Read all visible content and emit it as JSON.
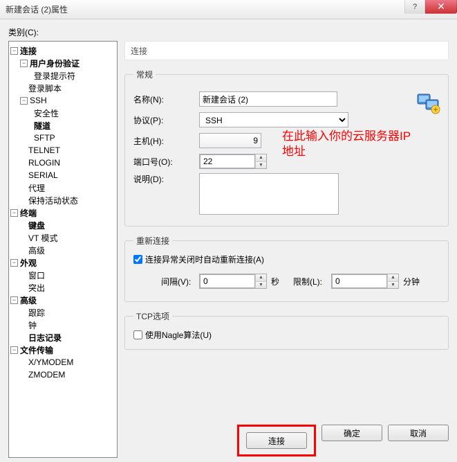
{
  "window": {
    "title": "新建会话 (2)属性",
    "help_symbol": "?",
    "close_symbol": "✕"
  },
  "category_label": "类别(C):",
  "tree": {
    "connection": "连接",
    "auth": "用户身份验证",
    "login_prompt": "登录提示符",
    "login_script": "登录脚本",
    "ssh": "SSH",
    "security": "安全性",
    "tunnel": "隧道",
    "sftp": "SFTP",
    "telnet": "TELNET",
    "rlogin": "RLOGIN",
    "serial": "SERIAL",
    "proxy": "代理",
    "keep_alive": "保持活动状态",
    "terminal": "终端",
    "keyboard": "键盘",
    "vt_mode": "VT 模式",
    "advanced_t": "高级",
    "appearance": "外观",
    "window": "窗口",
    "highlight": "突出",
    "advanced": "高级",
    "trace": "跟踪",
    "bell": "钟",
    "logging": "日志记录",
    "file_transfer": "文件传输",
    "xymodem": "X/YMODEM",
    "zmodem": "ZMODEM"
  },
  "header": "连接",
  "general": {
    "legend": "常规",
    "name_label": "名称(N):",
    "name_value": "新建会话 (2)",
    "protocol_label": "协议(P):",
    "protocol_value": "SSH",
    "host_label": "主机(H):",
    "host_value": "9",
    "port_label": "端口号(O):",
    "port_value": "22",
    "desc_label": "说明(D):",
    "desc_value": ""
  },
  "annotation": "在此输入你的云服务器IP地址",
  "reconnect": {
    "legend": "重新连接",
    "checkbox_label": "连接异常关闭时自动重新连接(A)",
    "checked": true,
    "interval_label": "间隔(V):",
    "interval_value": "0",
    "seconds": "秒",
    "limit_label": "限制(L):",
    "limit_value": "0",
    "minutes": "分钟"
  },
  "tcp": {
    "legend": "TCP选项",
    "nagle_label": "使用Nagle算法(U)",
    "nagle_checked": false
  },
  "buttons": {
    "connect": "连接",
    "ok": "确定",
    "cancel": "取消"
  }
}
